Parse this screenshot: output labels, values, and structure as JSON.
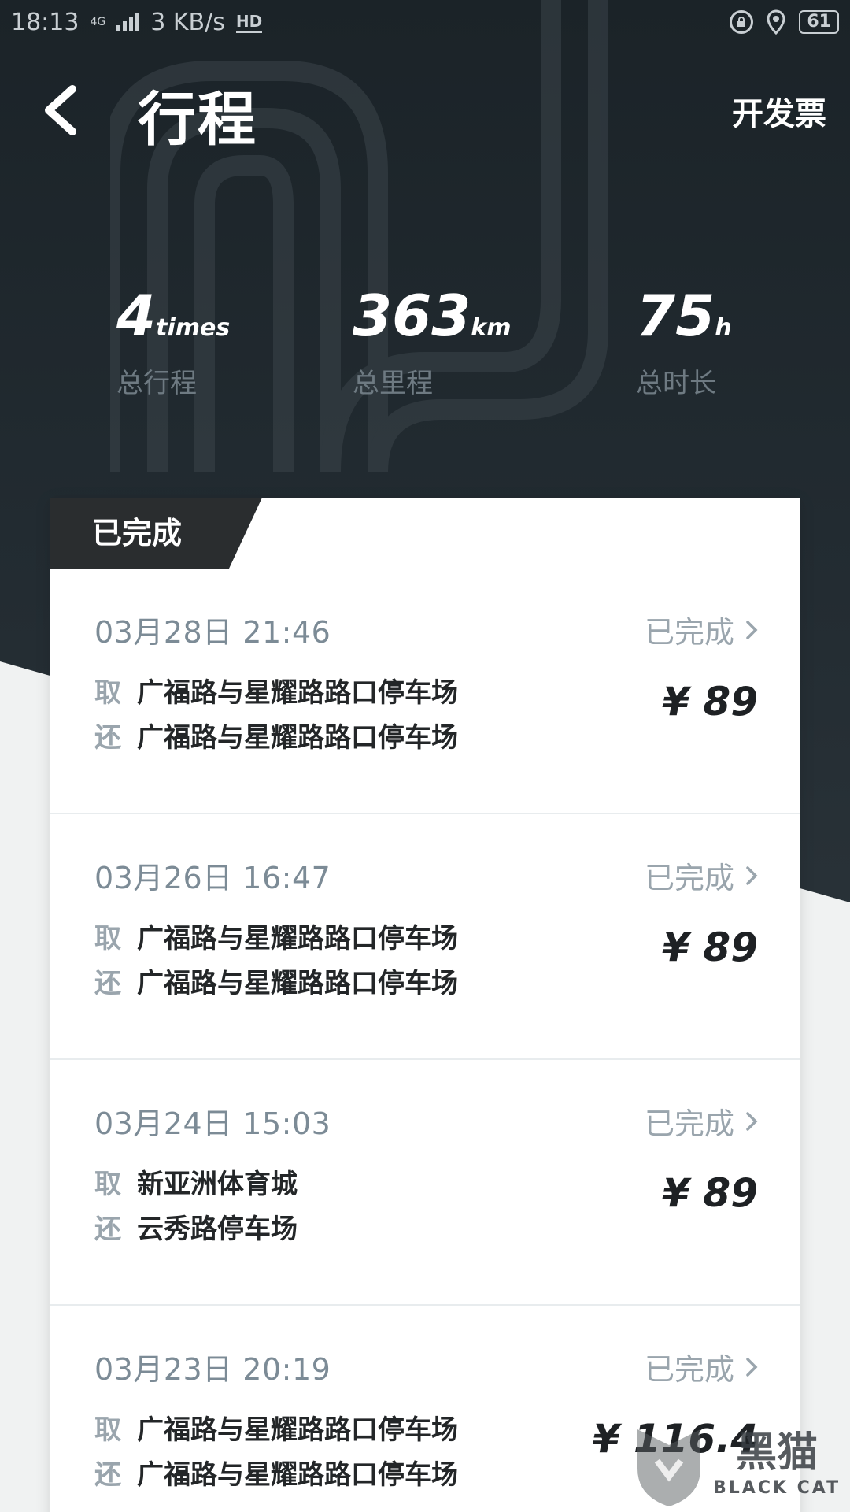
{
  "status_bar": {
    "time": "18:13",
    "network": "4G",
    "speed": "3 KB/s",
    "hd": "HD",
    "battery": "61"
  },
  "header": {
    "title": "行程",
    "invoice_label": "开发票"
  },
  "stats": [
    {
      "value": "4",
      "unit": "times",
      "label": "总行程"
    },
    {
      "value": "363",
      "unit": "km",
      "label": "总里程"
    },
    {
      "value": "75",
      "unit": "h",
      "label": "总时长"
    }
  ],
  "section": {
    "tab_label": "已完成"
  },
  "trips": [
    {
      "date": "03月28日 21:46",
      "status": "已完成",
      "pickup_tag": "取",
      "pickup": "广福路与星耀路路口停车场",
      "return_tag": "还",
      "return": "广福路与星耀路路口停车场",
      "price": "¥ 89"
    },
    {
      "date": "03月26日 16:47",
      "status": "已完成",
      "pickup_tag": "取",
      "pickup": "广福路与星耀路路口停车场",
      "return_tag": "还",
      "return": "广福路与星耀路路口停车场",
      "price": "¥ 89"
    },
    {
      "date": "03月24日 15:03",
      "status": "已完成",
      "pickup_tag": "取",
      "pickup": "新亚洲体育城",
      "return_tag": "还",
      "return": "云秀路停车场",
      "price": "¥ 89"
    },
    {
      "date": "03月23日 20:19",
      "status": "已完成",
      "pickup_tag": "取",
      "pickup": "广福路与星耀路路口停车场",
      "return_tag": "还",
      "return": "广福路与星耀路路口停车场",
      "price": "¥ 116.4"
    }
  ],
  "watermark": {
    "text_cn": "黑猫",
    "text_en": "BLACK CAT"
  }
}
